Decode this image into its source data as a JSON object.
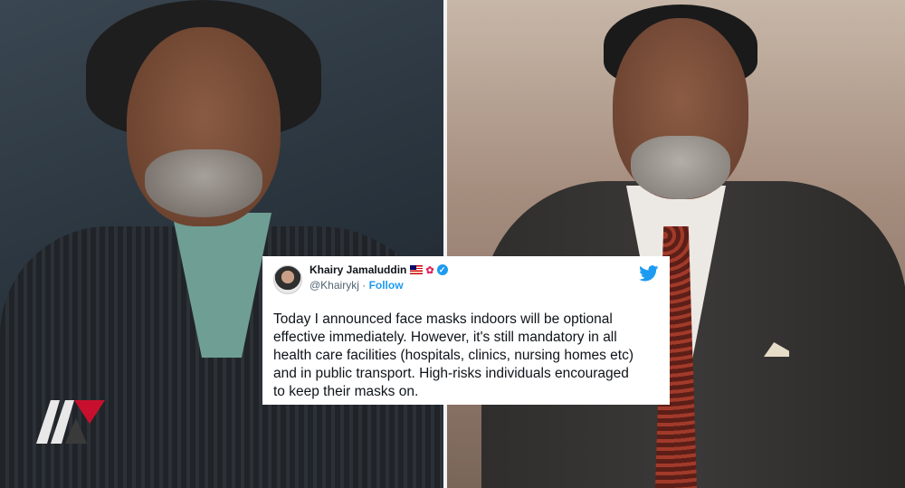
{
  "tweet": {
    "display_name": "Khairy Jamaluddin",
    "handle": "@Khairykj",
    "separator": "·",
    "follow_label": "Follow",
    "text": "Today I announced face masks indoors will be optional\neffective immediately. However, it's still mandatory in all\nhealth care facilities (hospitals, clinics, nursing homes etc)\nand in public transport. High-risks individuals encouraged\nto keep their masks on.",
    "verified_icon": "verified-badge-icon",
    "platform_icon": "twitter-bird-icon",
    "flag_icon": "malaysia-flag-icon",
    "flower_icon": "hibiscus-icon"
  },
  "colors": {
    "twitter_blue": "#1d9bf0",
    "logo_red": "#c8102e"
  }
}
